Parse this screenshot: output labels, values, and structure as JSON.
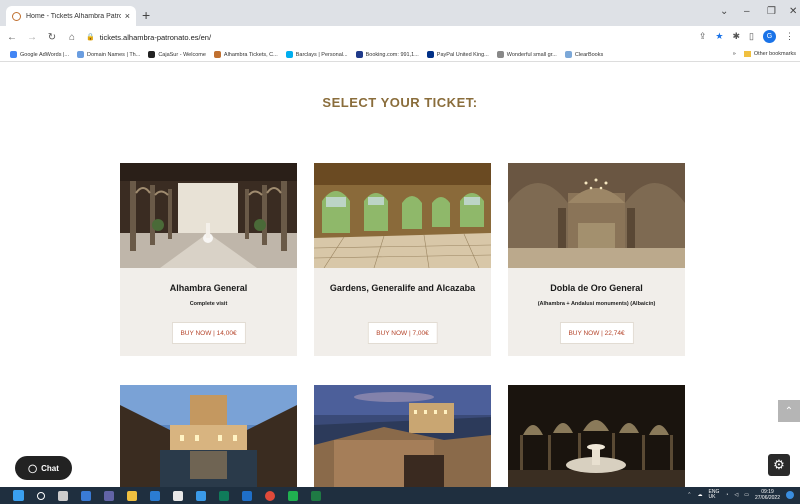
{
  "browser": {
    "tab_title": "Home - Tickets Alhambra Patron",
    "tab_close": "×",
    "new_tab": "+",
    "url": "tickets.alhambra-patronato.es/en/",
    "profile_initial": "G",
    "window_controls": [
      "⌄",
      "–",
      "❐",
      "✕"
    ]
  },
  "bookmarks": {
    "items": [
      {
        "label": "Google AdWords |...",
        "color": "#4285f4"
      },
      {
        "label": "Domain Names | Th...",
        "color": "#6a9de0"
      },
      {
        "label": "CajaSur - Welcome",
        "color": "#222222"
      },
      {
        "label": "Alhambra Tickets, C...",
        "color": "#c07030"
      },
      {
        "label": "Barclays | Personal...",
        "color": "#00aeef"
      },
      {
        "label": "Booking.com: 991,1...",
        "color": "#1f3a8a"
      },
      {
        "label": "PayPal United King...",
        "color": "#003087"
      },
      {
        "label": "Wonderful small gr...",
        "color": "#888888"
      },
      {
        "label": "ClearBooks",
        "color": "#7ca8d8"
      }
    ],
    "more": "»",
    "other": "Other bookmarks"
  },
  "page": {
    "heading": "SELECT YOUR TICKET:",
    "cards": [
      {
        "name": "Alhambra General",
        "sub": "Complete visit",
        "buy": "BUY NOW | 14,00€"
      },
      {
        "name": "Gardens, Generalife and Alcazaba",
        "sub": "",
        "buy": "BUY NOW | 7,00€"
      },
      {
        "name": "Dobla de Oro General",
        "sub": "(Alhambra + Andalusi monuments) (Albaicín)",
        "buy": "BUY NOW | 22,74€"
      }
    ],
    "chat_label": "Chat",
    "scroll_top_icon": "⌃",
    "settings_icon": "⚙"
  },
  "taskbar": {
    "lang": "ENG\nUK",
    "time": "09:19",
    "date": "27/06/2022"
  },
  "colors": {
    "heading": "#8a6d3b",
    "card_bg": "#f1eeea",
    "price": "#b5452b"
  }
}
